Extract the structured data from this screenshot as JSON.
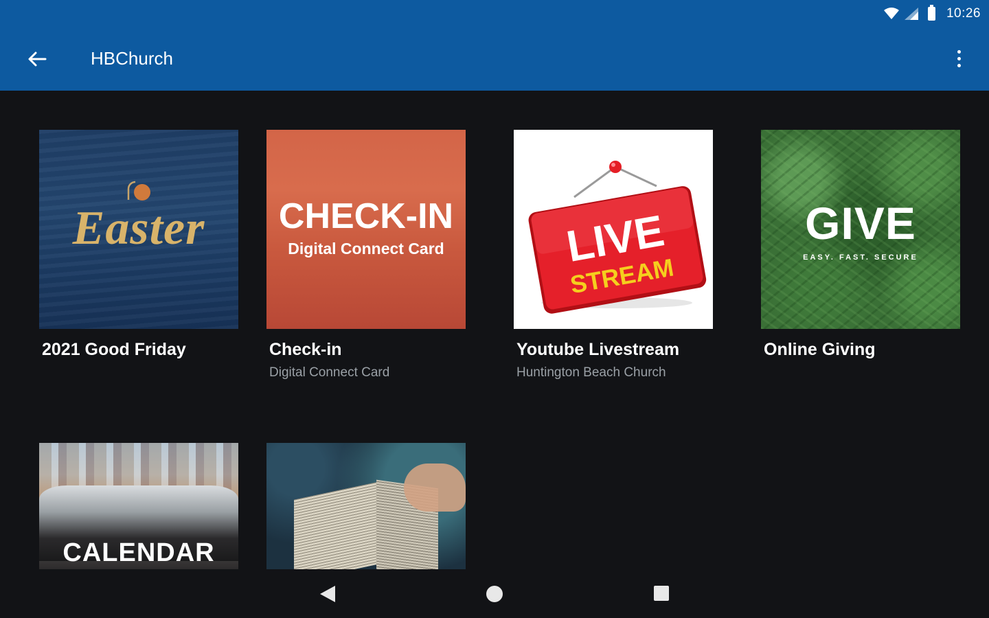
{
  "status_bar": {
    "time": "10:26"
  },
  "app_bar": {
    "title": "HBChurch"
  },
  "tiles": [
    {
      "title": "2021 Good Friday",
      "subtitle": "",
      "thumb_text": "Easter"
    },
    {
      "title": "Check-in",
      "subtitle": "Digital Connect Card",
      "thumb_text": "CHECK-IN",
      "thumb_subtext": "Digital Connect Card"
    },
    {
      "title": "Youtube Livestream",
      "subtitle": "Huntington Beach Church",
      "thumb_text": "LIVE",
      "thumb_subtext": "STREAM"
    },
    {
      "title": "Online Giving",
      "subtitle": "",
      "thumb_text": "GIVE",
      "thumb_subtext": "EASY. FAST. SECURE"
    },
    {
      "title": "",
      "subtitle": "",
      "thumb_text": "CALENDAR"
    },
    {
      "title": "",
      "subtitle": "",
      "thumb_text": ""
    }
  ],
  "colors": {
    "app_bar": "#0d5aa0",
    "background": "#121316",
    "subtitle": "#9aa0a6"
  }
}
